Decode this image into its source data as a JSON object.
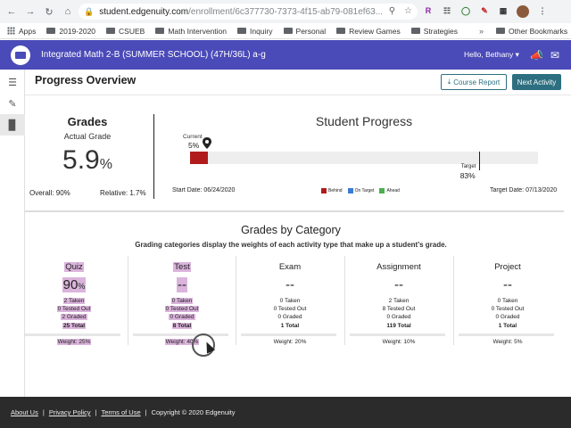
{
  "browser": {
    "url_host": "student.edgenuity.com",
    "url_path": "/enrollment/6c377730-7373-4f15-ab79-081ef63...",
    "bookmarks": [
      "Apps",
      "2019-2020",
      "CSUEB",
      "Math Intervention",
      "Inquiry",
      "Personal",
      "Review Games",
      "Strategies"
    ],
    "other_bookmarks": "Other Bookmarks",
    "ext_r": "R"
  },
  "header": {
    "course_title": "Integrated Math 2-B (SUMMER SCHOOL) (47H/36L) a-g",
    "greeting": "Hello, Bethany"
  },
  "page": {
    "title": "Progress Overview",
    "course_report_label": "Course Report",
    "next_activity_label": "Next Activity"
  },
  "grades": {
    "title": "Grades",
    "actual_label": "Actual Grade",
    "actual_value": "5.9",
    "actual_unit": "%",
    "overall": "Overall: 90%",
    "relative": "Relative: 1.7%"
  },
  "student_progress": {
    "title": "Student Progress",
    "current_label": "Current",
    "current_value": "5%",
    "current_fraction": 0.05,
    "target_label": "Target",
    "target_value": "83%",
    "target_fraction": 0.83,
    "start_date": "Start Date: 06/24/2020",
    "target_date": "Target Date: 07/13/2020",
    "legend": [
      {
        "label": "Behind",
        "color": "#b01c1c"
      },
      {
        "label": "On Target",
        "color": "#3a7bd5"
      },
      {
        "label": "Ahead",
        "color": "#4caf50"
      }
    ]
  },
  "grades_by_category": {
    "title": "Grades by Category",
    "subtitle": "Grading categories display the weights of each activity type that make up a student's grade.",
    "categories": [
      {
        "name": "Quiz",
        "grade": "90",
        "unit": "%",
        "taken": "2 Taken",
        "tested_out": "0 Tested Out",
        "graded": "2 Graded",
        "total": "25 Total",
        "weight": "Weight: 25%"
      },
      {
        "name": "Test",
        "grade": "--",
        "unit": "",
        "taken": "0 Taken",
        "tested_out": "0 Tested Out",
        "graded": "0 Graded",
        "total": "8 Total",
        "weight": "Weight: 40%"
      },
      {
        "name": "Exam",
        "grade": "--",
        "unit": "",
        "taken": "0 Taken",
        "tested_out": "0 Tested Out",
        "graded": "0 Graded",
        "total": "1 Total",
        "weight": "Weight: 20%"
      },
      {
        "name": "Assignment",
        "grade": "--",
        "unit": "",
        "taken": "2 Taken",
        "tested_out": "8 Tested Out",
        "graded": "0 Graded",
        "total": "119 Total",
        "weight": "Weight: 10%"
      },
      {
        "name": "Project",
        "grade": "--",
        "unit": "",
        "taken": "0 Taken",
        "tested_out": "0 Tested Out",
        "graded": "0 Graded",
        "total": "1 Total",
        "weight": "Weight: 5%"
      }
    ]
  },
  "footer": {
    "about": "About Us",
    "privacy": "Privacy Policy",
    "terms": "Terms of Use",
    "copyright": "Copyright © 2020 Edgenuity"
  }
}
